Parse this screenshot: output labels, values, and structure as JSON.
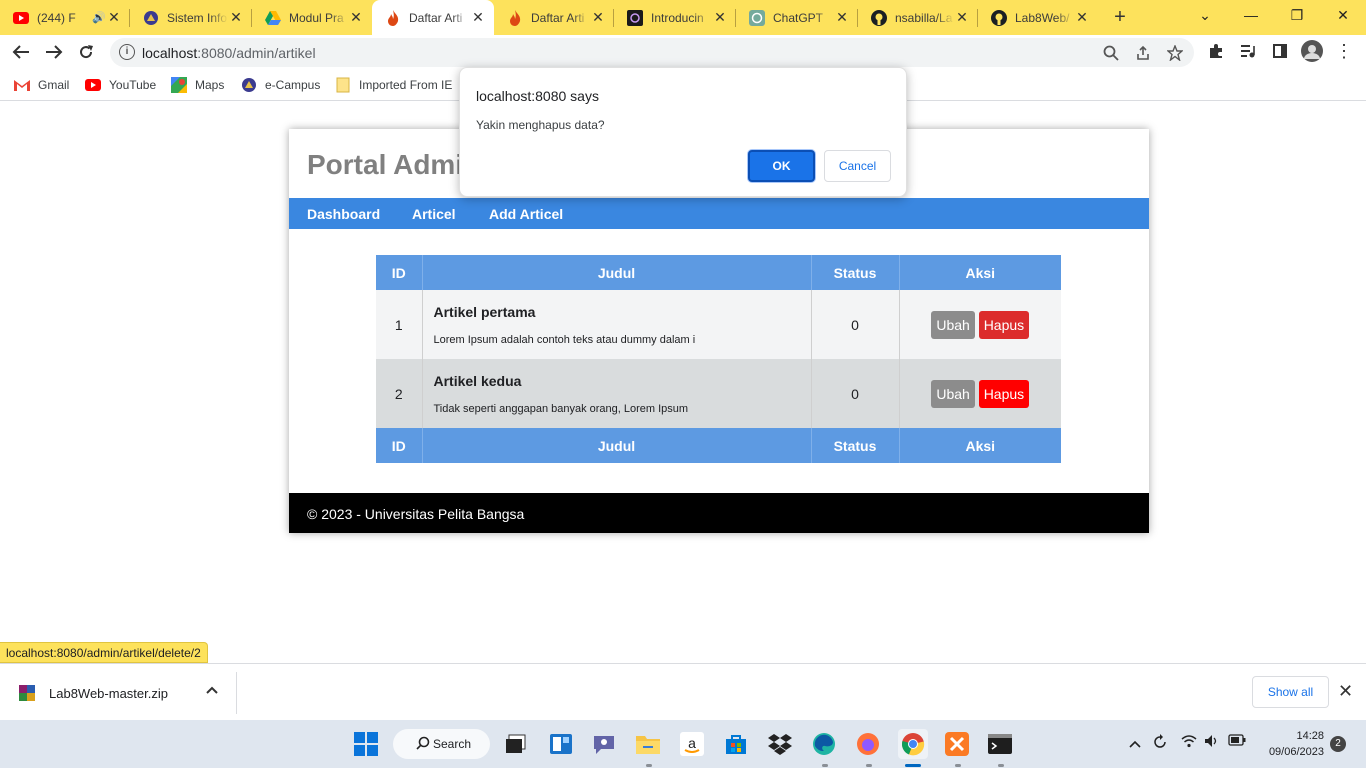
{
  "browser": {
    "tabs": [
      {
        "title": "(244) F",
        "icon": "youtube-icon",
        "has_audio": true
      },
      {
        "title": "Sistem Info",
        "icon": "campus-logo-icon"
      },
      {
        "title": "Modul Pra",
        "icon": "google-drive-icon"
      },
      {
        "title": "Daftar Arti",
        "icon": "codeigniter-icon",
        "active": true
      },
      {
        "title": "Daftar Arti",
        "icon": "codeigniter-icon"
      },
      {
        "title": "Introducin",
        "icon": "openai-icon"
      },
      {
        "title": "ChatGPT",
        "icon": "chatgpt-icon"
      },
      {
        "title": "nsabilla/La",
        "icon": "github-icon"
      },
      {
        "title": "Lab8Web/",
        "icon": "github-icon"
      }
    ],
    "url_host": "localhost",
    "url_path": ":8080/admin/artikel",
    "bookmarks": [
      {
        "label": "Gmail",
        "icon": "gmail-icon"
      },
      {
        "label": "YouTube",
        "icon": "youtube-icon"
      },
      {
        "label": "Maps",
        "icon": "maps-icon"
      },
      {
        "label": "e-Campus",
        "icon": "campus-logo-icon"
      },
      {
        "label": "Imported From IE",
        "icon": "folder-icon"
      }
    ],
    "status_url": "localhost:8080/admin/artikel/delete/2"
  },
  "site": {
    "title": "Portal Admin",
    "nav": [
      "Dashboard",
      "Articel",
      "Add Articel"
    ],
    "table": {
      "headers": [
        "ID",
        "Judul",
        "Status",
        "Aksi"
      ],
      "rows": [
        {
          "id": "1",
          "title": "Artikel pertama",
          "desc": "Lorem Ipsum adalah contoh teks atau dummy dalam i",
          "status": "0",
          "edit": "Ubah",
          "delete": "Hapus"
        },
        {
          "id": "2",
          "title": "Artikel kedua",
          "desc": "Tidak seperti anggapan banyak orang, Lorem Ipsum",
          "status": "0",
          "edit": "Ubah",
          "delete": "Hapus"
        }
      ]
    },
    "footer": "© 2023 - Universitas Pelita Bangsa"
  },
  "dialog": {
    "title": "localhost:8080 says",
    "message": "Yakin menghapus data?",
    "ok": "OK",
    "cancel": "Cancel"
  },
  "downloads": {
    "file": "Lab8Web-master.zip",
    "show_all": "Show all"
  },
  "taskbar": {
    "search": "Search",
    "time": "14:28",
    "date": "09/06/2023",
    "notifications": "2"
  },
  "colors": {
    "chrome_theme": "#fde25c",
    "nav": "#3a87e0",
    "table_header": "#5d9ae2",
    "hapus": "#e81f1f",
    "ubah": "#8c8c8c"
  }
}
